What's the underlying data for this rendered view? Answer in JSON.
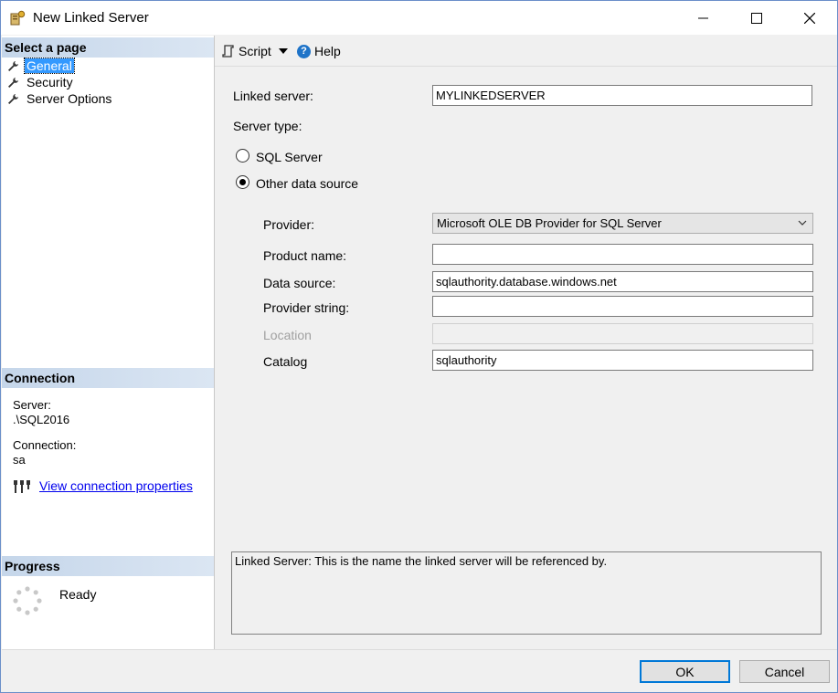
{
  "window": {
    "title": "New Linked Server"
  },
  "left": {
    "select_header": "Select a page",
    "pages": [
      {
        "label": "General"
      },
      {
        "label": "Security"
      },
      {
        "label": "Server Options"
      }
    ],
    "connection_header": "Connection",
    "server_label": "Server:",
    "server_value": ".\\SQL2016",
    "connection_label": "Connection:",
    "connection_value": "sa",
    "view_props_link": "View connection properties",
    "progress_header": "Progress",
    "progress_status": "Ready"
  },
  "toolbar": {
    "script_label": "Script",
    "help_label": "Help"
  },
  "form": {
    "linked_server_label": "Linked server:",
    "linked_server_value": "MYLINKEDSERVER",
    "server_type_label": "Server type:",
    "sql_server_label": "SQL Server",
    "other_source_label": "Other data source",
    "provider_label": "Provider:",
    "provider_value": "Microsoft OLE DB Provider for SQL Server",
    "product_name_label": "Product name:",
    "product_name_value": "",
    "data_source_label": "Data source:",
    "data_source_value": "sqlauthority.database.windows.net",
    "provider_string_label": "Provider string:",
    "provider_string_value": "",
    "location_label": "Location",
    "location_value": "",
    "catalog_label": "Catalog",
    "catalog_value": "sqlauthority"
  },
  "description": "Linked Server: This is the name the linked server will be referenced by.",
  "buttons": {
    "ok": "OK",
    "cancel": "Cancel"
  }
}
